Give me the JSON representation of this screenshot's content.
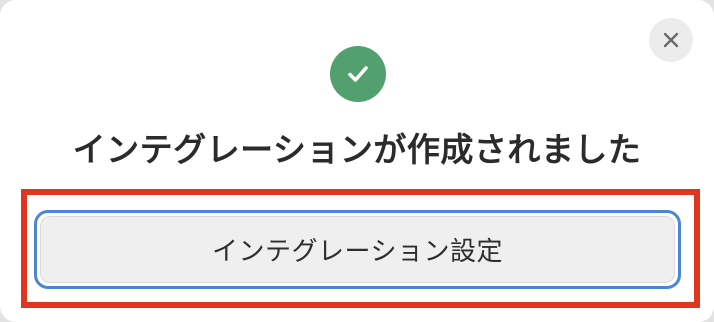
{
  "dialog": {
    "title": "インテグレーションが作成されました",
    "status_icon": "check-circle-icon",
    "close_icon": "close-icon",
    "primary_button_label": "インテグレーション設定"
  },
  "colors": {
    "success": "#52a06e",
    "highlight": "#e0351f",
    "focus_ring": "#4a86d4"
  }
}
